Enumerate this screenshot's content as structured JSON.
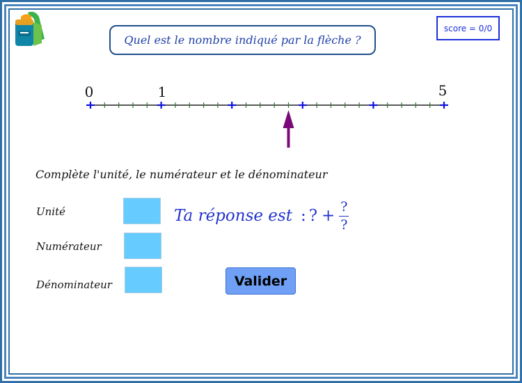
{
  "question": "Quel est le nombre indiqué par la flèche ?",
  "score": "score = 0/0",
  "number_line": {
    "labels": [
      "0",
      "1",
      "5"
    ],
    "arrow_value": 2.8
  },
  "instruction": "Complète l'unité, le numérateur et le dénominateur",
  "fields": {
    "unit_label": "Unité",
    "numerator_label": "Numérateur",
    "denominator_label": "Dénominateur",
    "unit_value": "",
    "numerator_value": "",
    "denominator_value": ""
  },
  "answer": {
    "prefix": "Ta réponse est",
    "colon": ":",
    "whole": "?",
    "plus": "+",
    "numerator": "?",
    "denominator": "?"
  },
  "validate_label": "Valider",
  "colors": {
    "frame": "#2f6fa6",
    "box": "#66ccff",
    "button": "#6fa0f5",
    "arrow": "#7a0a7a",
    "tick_major": "#1010dd",
    "tick_minor": "#2b7a2b"
  }
}
